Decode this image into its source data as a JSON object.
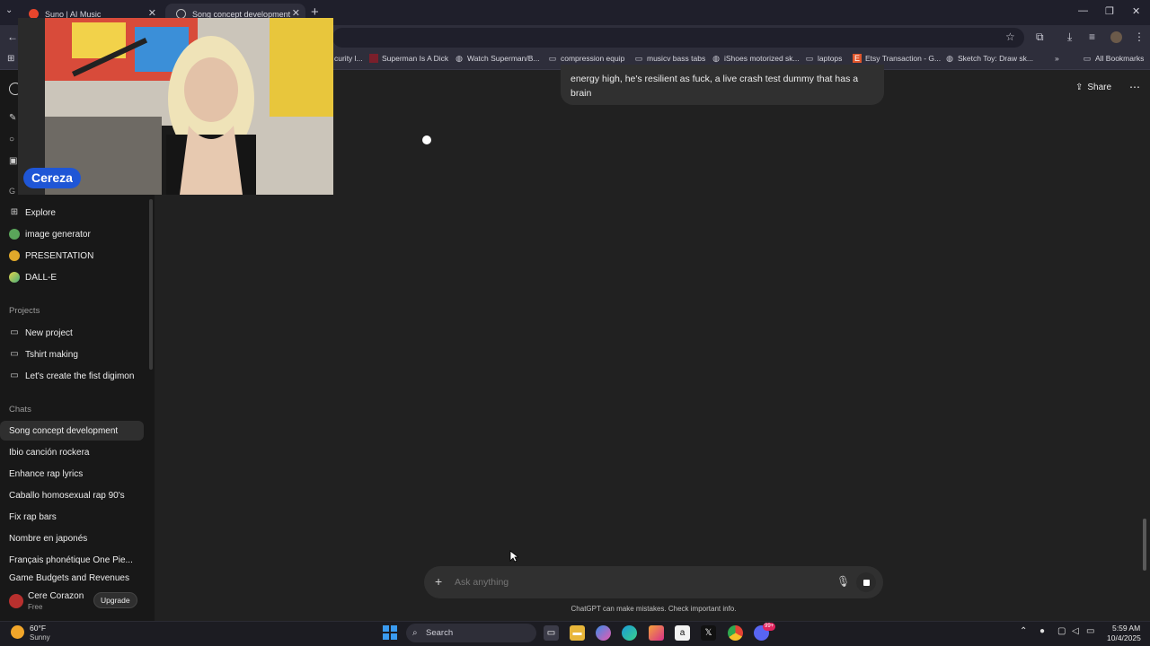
{
  "browser": {
    "tabs": [
      {
        "title": "Suno | AI Music",
        "active": false,
        "favicon_color": "#e8452c"
      },
      {
        "title": "Song concept development",
        "active": true,
        "favicon_color": "#a0a0a0"
      }
    ],
    "new_tab_icon": "plus-icon",
    "window_controls": [
      "minimize-icon",
      "restore-icon",
      "close-icon"
    ],
    "bookmarks": [
      {
        "label": "curity l...",
        "icon": "bookmark-icon"
      },
      {
        "label": "Superman Is A Dick",
        "icon": "site-icon"
      },
      {
        "label": "Watch Superman/B...",
        "icon": "site-icon"
      },
      {
        "label": "compression equip",
        "icon": "folder-icon"
      },
      {
        "label": "musicv bass tabs",
        "icon": "folder-icon"
      },
      {
        "label": "iShoes motorized sk...",
        "icon": "site-icon"
      },
      {
        "label": "laptops",
        "icon": "folder-icon"
      },
      {
        "label": "Etsy Transaction - G...",
        "icon": "etsy-icon"
      },
      {
        "label": "Sketch Toy: Draw sk...",
        "icon": "site-icon"
      }
    ],
    "all_bookmarks_label": "All Bookmarks"
  },
  "webcam": {
    "name_label": "Cereza"
  },
  "sidebar": {
    "gpts": [
      {
        "label": "Explore",
        "icon": "grid-icon"
      },
      {
        "label": "image generator",
        "icon": "gpt-avatar-icon"
      },
      {
        "label": "PRESENTATION",
        "icon": "gpt-avatar-icon"
      },
      {
        "label": "DALL-E",
        "icon": "gpt-avatar-icon"
      }
    ],
    "projects_heading": "Projects",
    "projects": [
      {
        "label": "New project",
        "icon": "folder-plus-icon"
      },
      {
        "label": "Tshirt making",
        "icon": "folder-icon"
      },
      {
        "label": "Let's create the fist digimon",
        "icon": "folder-icon"
      }
    ],
    "chats_heading": "Chats",
    "chats": [
      {
        "label": "Song concept development",
        "active": true
      },
      {
        "label": "Ibio canción rockera",
        "active": false
      },
      {
        "label": "Enhance rap lyrics",
        "active": false
      },
      {
        "label": "Caballo homosexual rap 90's",
        "active": false
      },
      {
        "label": "Fix rap bars",
        "active": false
      },
      {
        "label": "Nombre en japonés",
        "active": false
      },
      {
        "label": "Français phonétique One Pie...",
        "active": false
      },
      {
        "label": "Game Budgets and Revenues",
        "active": false
      }
    ],
    "user": {
      "name": "Cere Corazon",
      "plan": "Free",
      "upgrade_label": "Upgrade"
    }
  },
  "main": {
    "user_message_line1": "energy high, he's resilient as fuck, a live crash test dummy that has a",
    "user_message_line2": "brain",
    "share_label": "Share",
    "composer_placeholder": "Ask anything",
    "disclaimer": "ChatGPT can make mistakes. Check important info."
  },
  "taskbar": {
    "weather_temp": "60°F",
    "weather_desc": "Sunny",
    "search_label": "Search",
    "time": "5:59 AM",
    "date": "10/4/2025",
    "notification_count": "99+"
  }
}
